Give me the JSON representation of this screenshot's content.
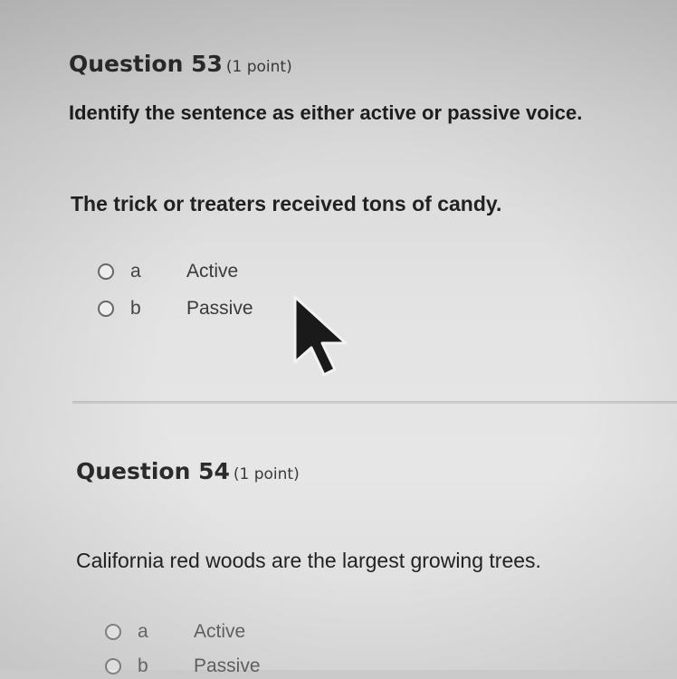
{
  "questions": [
    {
      "number": "Question 53",
      "points": "(1 point)",
      "instruction": "Identify the sentence as either active or passive voice.",
      "prompt": "The trick or treaters received tons of candy.",
      "options": [
        {
          "letter": "a",
          "text": "Active"
        },
        {
          "letter": "b",
          "text": "Passive"
        }
      ]
    },
    {
      "number": "Question 54",
      "points": "(1 point)",
      "prompt": "California red woods are the largest growing trees.",
      "options": [
        {
          "letter": "a",
          "text": "Active"
        },
        {
          "letter": "b",
          "text": "Passive"
        }
      ]
    }
  ],
  "cursor": {
    "icon": "mouse-pointer-arrow-icon"
  }
}
